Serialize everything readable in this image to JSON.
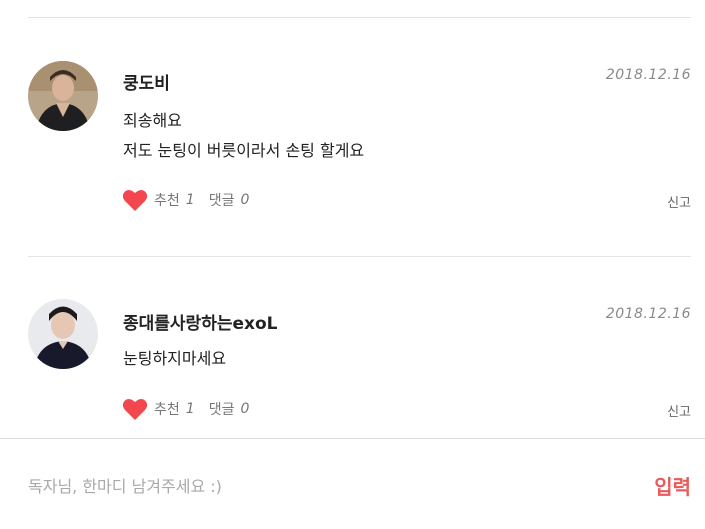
{
  "comments": [
    {
      "author": "쿵도비",
      "date": "2018.12.16",
      "lines": [
        "죄송해요",
        "저도 눈팅이 버릇이라서 손팅 할게요"
      ],
      "like_label": "추천",
      "like_count": "1",
      "reply_label": "댓글",
      "reply_count": "0",
      "report_label": "신고"
    },
    {
      "author": "종대를사랑하는exoL",
      "date": "2018.12.16",
      "lines": [
        "눈팅하지마세요"
      ],
      "like_label": "추천",
      "like_count": "1",
      "reply_label": "댓글",
      "reply_count": "0",
      "report_label": "신고"
    }
  ],
  "input": {
    "placeholder": "독자님, 한마디 남겨주세요 :)",
    "value": "",
    "submit_label": "입력"
  },
  "colors": {
    "accent": "#ea5a5a",
    "heart": "#f2474f",
    "divider": "#e4e4e4"
  }
}
